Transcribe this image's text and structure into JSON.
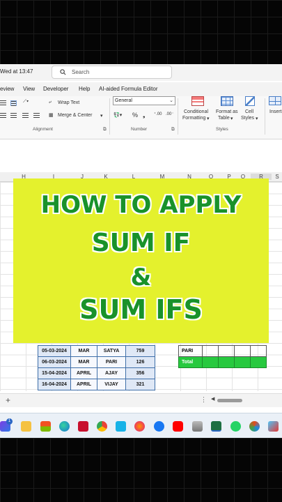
{
  "titlebar": {
    "saved_text": "Wed at 13:47",
    "search_placeholder": "Search"
  },
  "menu": [
    "eview",
    "View",
    "Developer",
    "Help",
    "AI-aided Formula Editor"
  ],
  "ribbon": {
    "wrap_text": "Wrap Text",
    "merge_center": "Merge & Center",
    "number_format": "General",
    "conditional_formatting": [
      "Conditional",
      "Formatting"
    ],
    "format_as_table": [
      "Format as",
      "Table"
    ],
    "cell_styles": [
      "Cell",
      "Styles"
    ],
    "insert": "Insert",
    "groups": {
      "alignment": "Alignment",
      "number": "Number",
      "styles": "Styles"
    }
  },
  "columns": [
    "H",
    "I",
    "J",
    "K",
    "L",
    "M",
    "N",
    "O",
    "P",
    "Q",
    "R",
    "S"
  ],
  "banner": {
    "bg_color": "#e4f12d",
    "text_color": "#19922a",
    "lines": [
      "HOW TO APPLY",
      "SUM IF",
      "&",
      "SUM IFS"
    ]
  },
  "table": {
    "rows": [
      [
        "05-03-2024",
        "MAR",
        "SATYA",
        "759"
      ],
      [
        "06-03-2024",
        "MAR",
        "PARI",
        "126"
      ],
      [
        "15-04-2024",
        "APRIL",
        "AJAY",
        "356"
      ],
      [
        "16-04-2024",
        "APRIL",
        "VIJAY",
        "321"
      ]
    ]
  },
  "summary": {
    "name": "PARI",
    "total": "Total",
    "total_color": "#27c93f"
  },
  "taskbar": {
    "badges": [
      "1"
    ],
    "icons": [
      "copilot-icon",
      "file-explorer-icon",
      "store-icon",
      "edge-icon",
      "mcafee-icon",
      "chrome-icon",
      "kodi-icon",
      "firefox-icon",
      "facebook-icon",
      "youtube-icon",
      "photos-icon",
      "excel-icon",
      "whatsapp-icon",
      "snipping-icon",
      "app-icon"
    ]
  }
}
